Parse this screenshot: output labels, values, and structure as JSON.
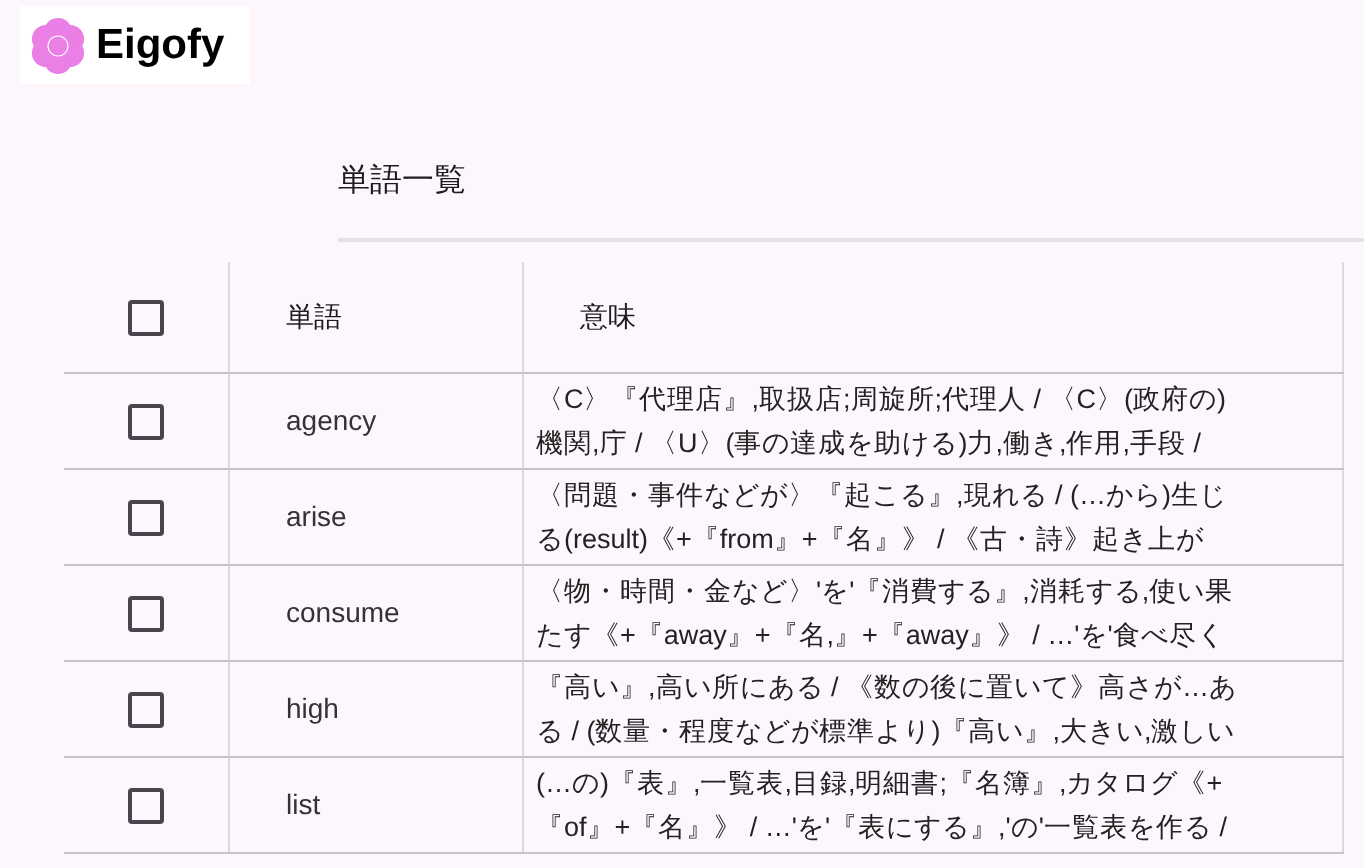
{
  "logo": {
    "text": "Eigofy"
  },
  "page_title": "単語一覧",
  "table": {
    "header": {
      "checked": false,
      "columns": [
        "単語",
        "意味"
      ]
    },
    "rows": [
      {
        "checked": false,
        "word": "agency",
        "meaning_lines": [
          "〈C〉『代理店』,取扱店;周旋所;代理人 / 〈C〉(政府の)",
          "機関,庁 / 〈U〉(事の達成を助ける)力,働き,作用,手段 /"
        ]
      },
      {
        "checked": false,
        "word": "arise",
        "meaning_lines": [
          "〈問題・事件などが〉『起こる』,現れる / (…から)生じ",
          "る(result)《+『from』+『名』》 / 《古・詩》起き上が"
        ]
      },
      {
        "checked": false,
        "word": "consume",
        "meaning_lines": [
          "〈物・時間・金など〉'を'『消費する』,消耗する,使い果",
          "たす《+『away』+『名,』+『away』》 / …'を'食べ尽く"
        ]
      },
      {
        "checked": false,
        "word": "high",
        "meaning_lines": [
          "『高い』,高い所にある / 《数の後に置いて》高さが…あ",
          "る / (数量・程度などが標準より)『高い』,大きい,激しい"
        ]
      },
      {
        "checked": false,
        "word": "list",
        "meaning_lines": [
          "(…の)『表』,一覧表,目録,明細書;『名簿』,カタログ《+",
          "『of』+『名』》 / …'を'『表にする』,'の'一覧表を作る /"
        ]
      }
    ]
  }
}
